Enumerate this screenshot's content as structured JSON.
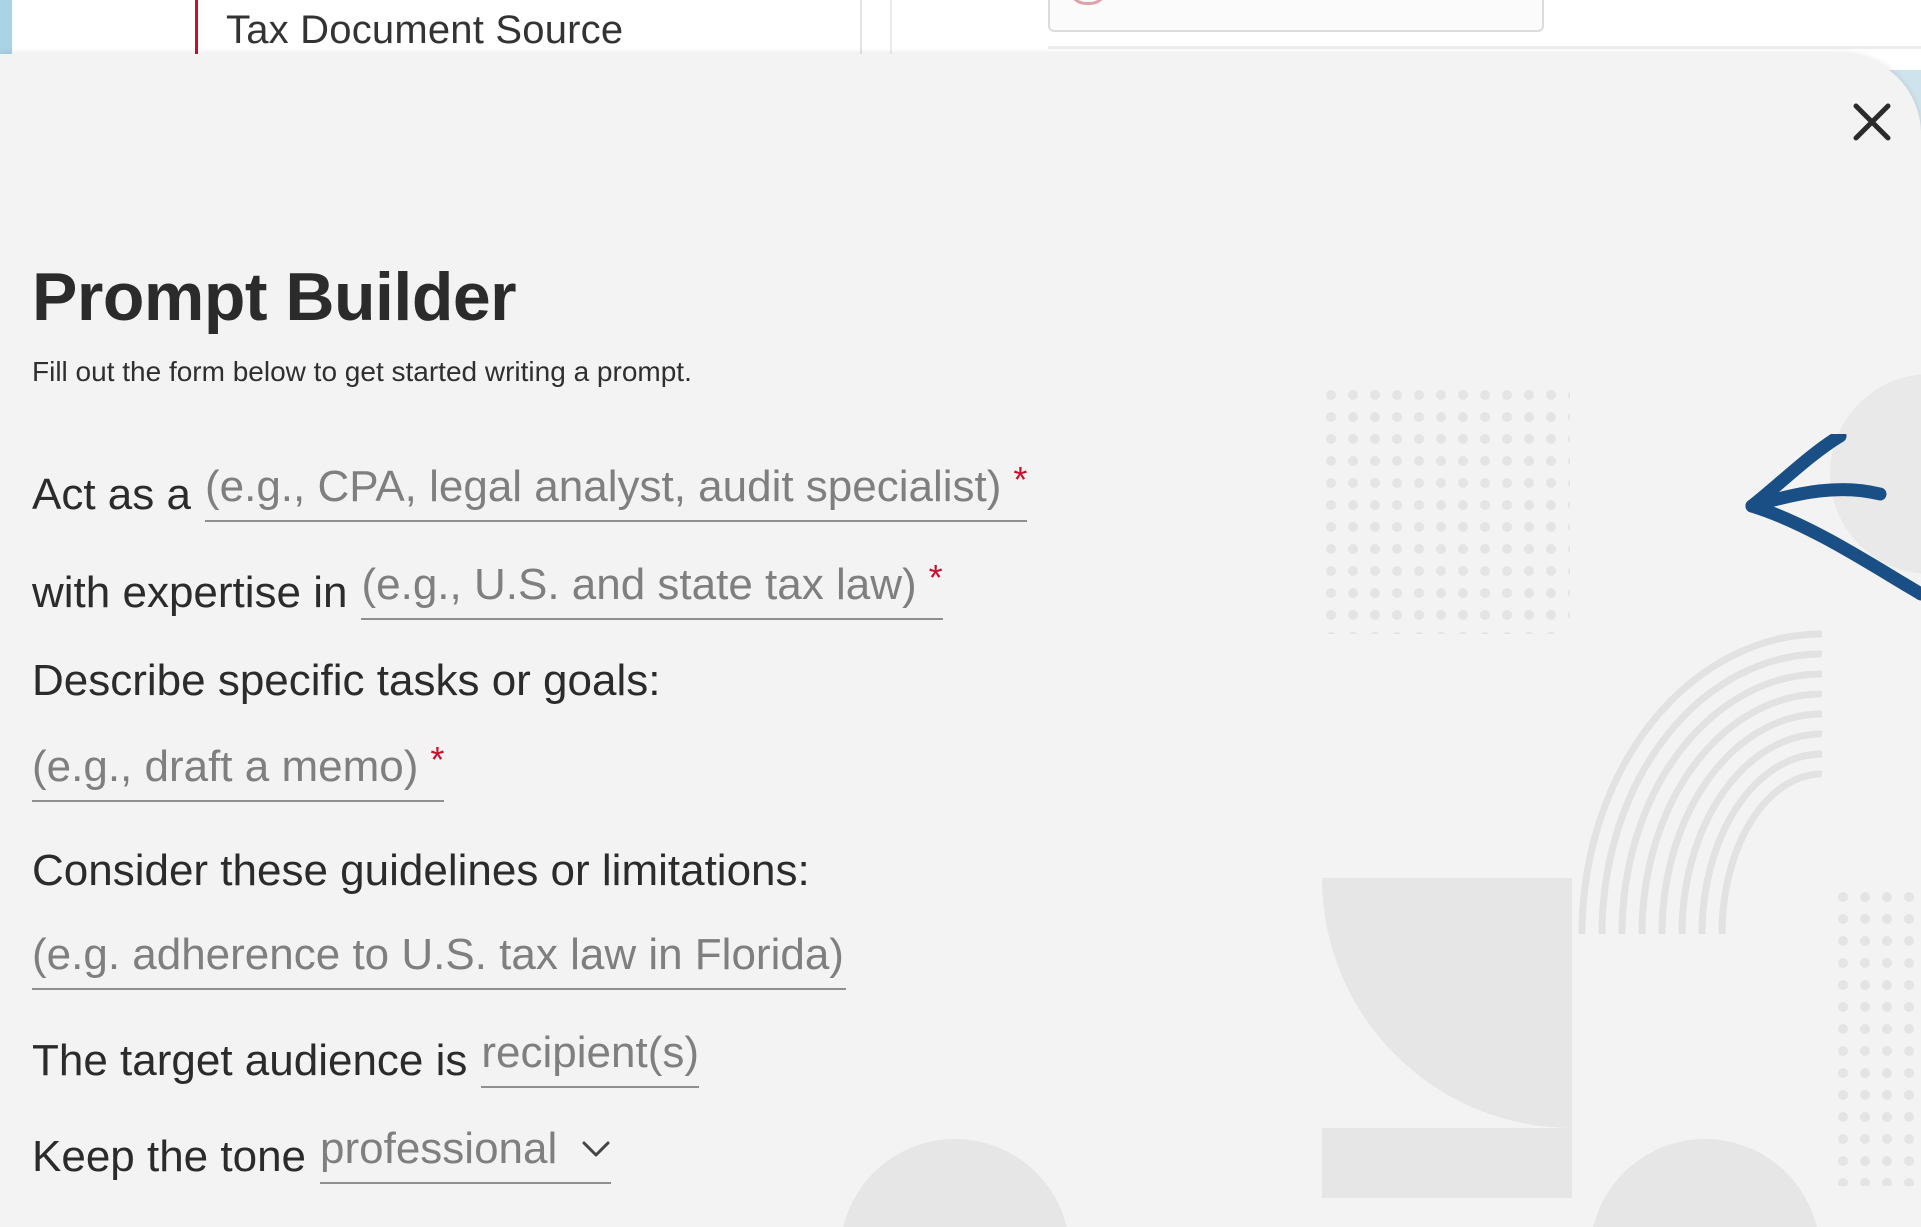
{
  "background": {
    "document_label": "Tax Document Source"
  },
  "modal": {
    "title": "Prompt Builder",
    "subtitle": "Fill out the form below to get started writing a prompt.",
    "fields": {
      "act_as": {
        "label": "Act as a",
        "placeholder": "(e.g., CPA, legal analyst, audit specialist)",
        "required_mark": "*"
      },
      "expertise": {
        "label": "with expertise in",
        "placeholder": "(e.g., U.S. and state tax law)",
        "required_mark": "*"
      },
      "tasks": {
        "label": "Describe specific tasks or goals:",
        "placeholder": "(e.g., draft a memo)",
        "required_mark": "*"
      },
      "guidelines": {
        "label": "Consider these guidelines or limitations:",
        "placeholder": "(e.g. adherence to U.S. tax law in Florida)"
      },
      "audience": {
        "label": "The target audience is",
        "placeholder": "recipient(s)"
      },
      "tone": {
        "label": "Keep the tone",
        "selected": "professional"
      }
    }
  },
  "colors": {
    "required": "#c8102e",
    "arrow": "#1a4f86",
    "panel": "#f3f3f3"
  },
  "icons": {
    "close": "close-icon",
    "tone_dropdown": "chevron-down-icon",
    "annotation": "arrow-left-icon"
  }
}
